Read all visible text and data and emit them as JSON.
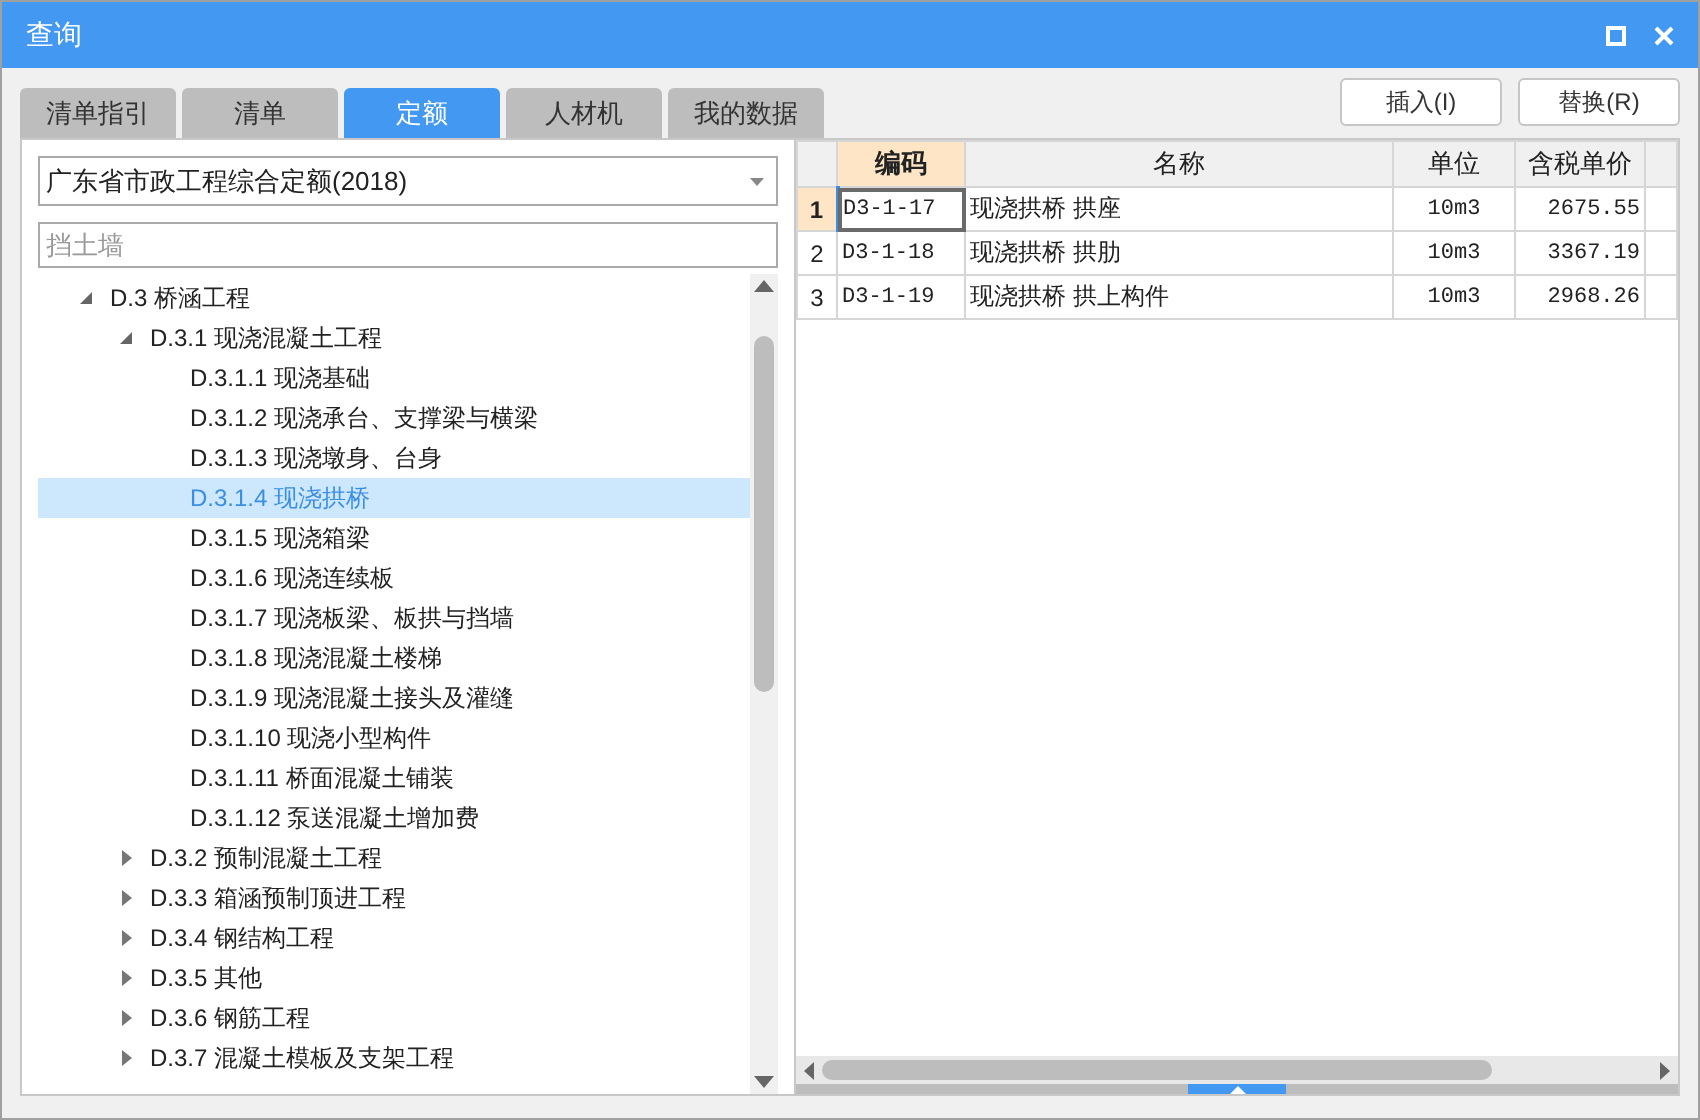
{
  "window": {
    "title": "查询"
  },
  "tabs": [
    {
      "label": "清单指引",
      "selected": false
    },
    {
      "label": "清单",
      "selected": false
    },
    {
      "label": "定额",
      "selected": true
    },
    {
      "label": "人材机",
      "selected": false
    },
    {
      "label": "我的数据",
      "selected": false
    }
  ],
  "buttons": [
    "插入(I)",
    "替换(R)"
  ],
  "library_select": {
    "value": "广东省市政工程综合定额(2018)"
  },
  "search": {
    "placeholder": "挡土墙"
  },
  "tree": [
    {
      "label": "D.3 桥涵工程",
      "expanded": true,
      "selected": false,
      "children": [
        {
          "label": "D.3.1 现浇混凝土工程",
          "expanded": true,
          "selected": false,
          "children": [
            {
              "label": "D.3.1.1 现浇基础",
              "selected": false
            },
            {
              "label": "D.3.1.2 现浇承台、支撑梁与横梁",
              "selected": false
            },
            {
              "label": "D.3.1.3 现浇墩身、台身",
              "selected": false
            },
            {
              "label": "D.3.1.4 现浇拱桥",
              "selected": true
            },
            {
              "label": "D.3.1.5 现浇箱梁",
              "selected": false
            },
            {
              "label": "D.3.1.6 现浇连续板",
              "selected": false
            },
            {
              "label": "D.3.1.7 现浇板梁、板拱与挡墙",
              "selected": false
            },
            {
              "label": "D.3.1.8 现浇混凝土楼梯",
              "selected": false
            },
            {
              "label": "D.3.1.9 现浇混凝土接头及灌缝",
              "selected": false
            },
            {
              "label": "D.3.1.10 现浇小型构件",
              "selected": false
            },
            {
              "label": "D.3.1.11 桥面混凝土铺装",
              "selected": false
            },
            {
              "label": "D.3.1.12 泵送混凝土增加费",
              "selected": false
            }
          ]
        },
        {
          "label": "D.3.2 预制混凝土工程",
          "expanded": false,
          "selected": false
        },
        {
          "label": "D.3.3 箱涵预制顶进工程",
          "expanded": false,
          "selected": false
        },
        {
          "label": "D.3.4 钢结构工程",
          "expanded": false,
          "selected": false
        },
        {
          "label": "D.3.5 其他",
          "expanded": false,
          "selected": false
        },
        {
          "label": "D.3.6 钢筋工程",
          "expanded": false,
          "selected": false
        },
        {
          "label": "D.3.7 混凝土模板及支架工程",
          "expanded": false,
          "selected": false
        }
      ]
    }
  ],
  "table": {
    "columns": [
      "编码",
      "名称",
      "单位",
      "含税单价"
    ],
    "rows": [
      {
        "number": "1",
        "selected": true,
        "cells": [
          "D3-1-17",
          "现浇拱桥 拱座",
          "10m3",
          "2675.55"
        ]
      },
      {
        "number": "2",
        "selected": false,
        "cells": [
          "D3-1-18",
          "现浇拱桥 拱肋",
          "10m3",
          "3367.19"
        ]
      },
      {
        "number": "3",
        "selected": false,
        "cells": [
          "D3-1-19",
          "现浇拱桥 拱上构件",
          "10m3",
          "2968.26"
        ]
      }
    ]
  }
}
